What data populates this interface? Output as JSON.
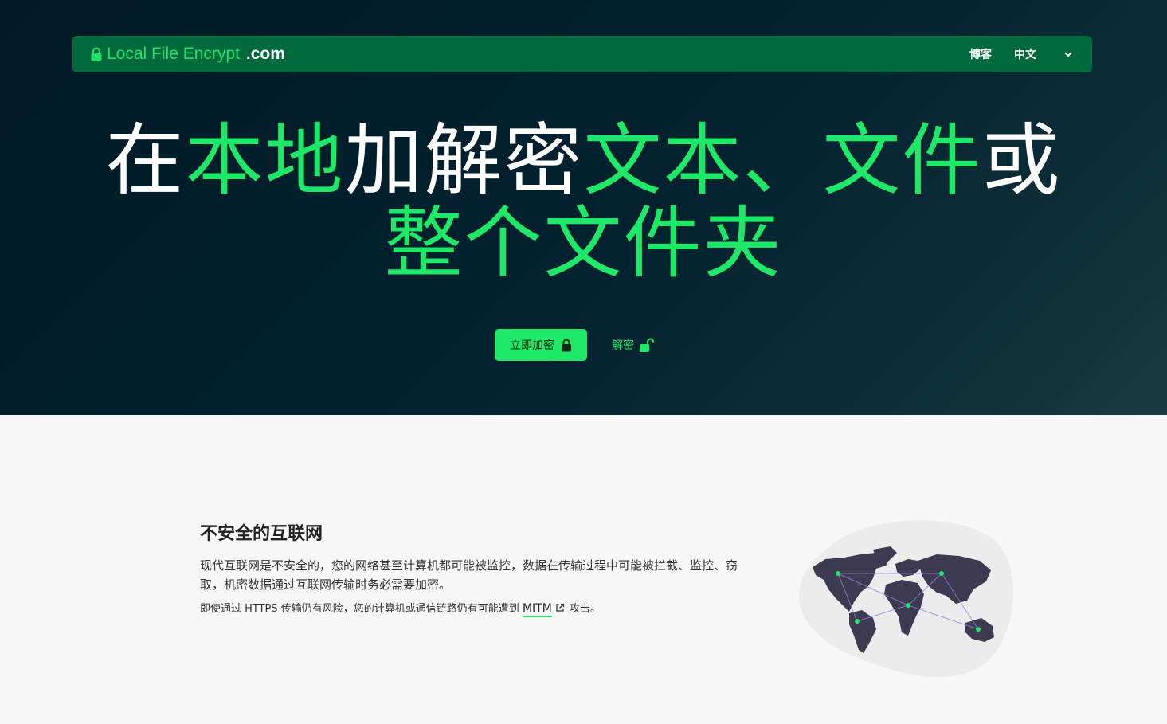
{
  "nav": {
    "brand": "Local File Encrypt",
    "brand_tld": ".com",
    "blog": "博客",
    "language": "中文"
  },
  "hero": {
    "headline": [
      {
        "text": "在",
        "color": "#ffffff"
      },
      {
        "text": "本地",
        "color": "#1ee868"
      },
      {
        "text": "加解密",
        "color": "#ffffff"
      },
      {
        "text": "文本、文件",
        "color": "#1ee868"
      },
      {
        "text": "或",
        "color": "#ffffff"
      },
      {
        "text": "整个文件夹",
        "color": "#1ee868"
      }
    ],
    "encrypt_button": "立即加密",
    "decrypt_button": "解密"
  },
  "section": {
    "title": "不安全的互联网",
    "paragraph": "现代互联网是不安全的，您的网络甚至计算机都可能被监控，数据在传输过程中可能被拦截、监控、窃取，机密数据通过互联网传输时务必需要加密。",
    "note_before": "即使通过 HTTPS 传输仍有风险，您的计算机或通信链路仍有可能遭到",
    "note_link": "MITM",
    "note_after": "攻击。"
  },
  "colors": {
    "accent": "#1ee868",
    "navbar": "#006a3c",
    "hero_bg": "#011d28"
  },
  "icons": {
    "brand": "lock-icon",
    "language": "chevron-down-icon",
    "encrypt": "lock-icon",
    "decrypt": "unlock-icon",
    "link": "external-link-icon",
    "illustration": "world-map-illustration"
  }
}
